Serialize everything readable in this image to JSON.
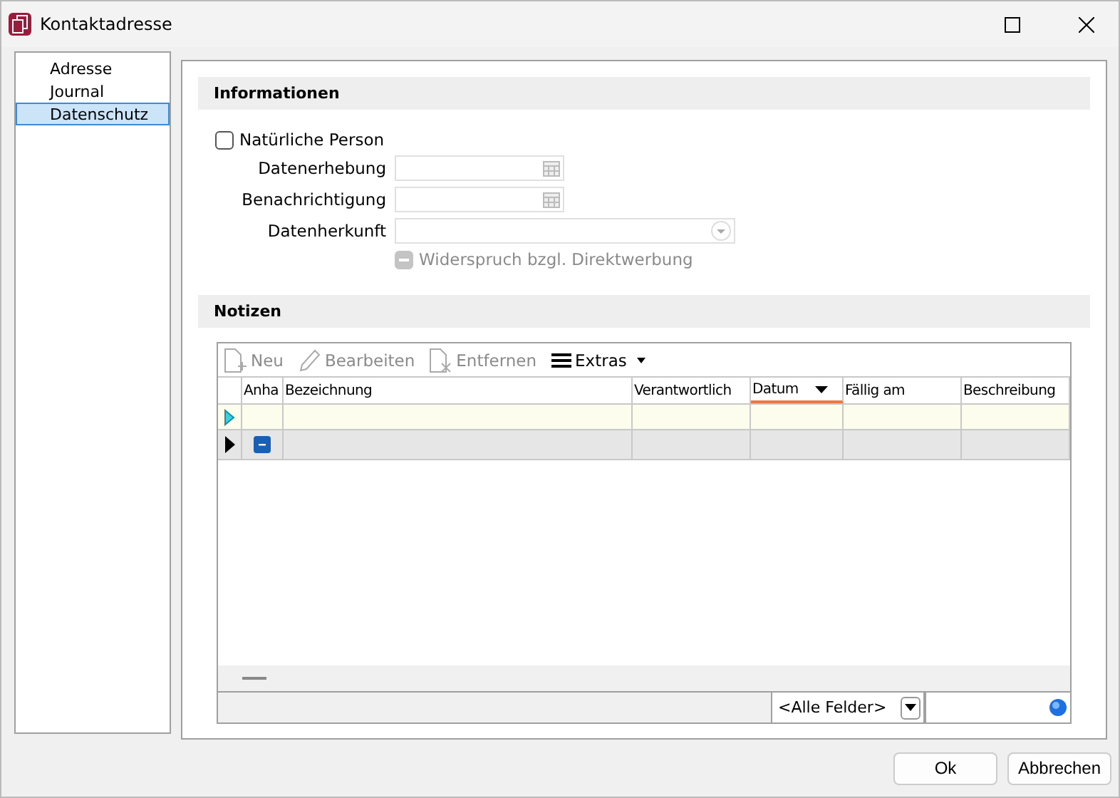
{
  "window": {
    "title": "Kontaktadresse"
  },
  "nav": {
    "items": [
      {
        "label": "Adresse",
        "selected": false
      },
      {
        "label": "Journal",
        "selected": false
      },
      {
        "label": "Datenschutz",
        "selected": true
      }
    ]
  },
  "informationen": {
    "title": "Informationen",
    "natural_person": {
      "label": "Natürliche Person",
      "checked": false
    },
    "fields": [
      {
        "label": "Datenerhebung",
        "kind": "date"
      },
      {
        "label": "Benachrichtigung",
        "kind": "date"
      },
      {
        "label": "Datenherkunft",
        "kind": "select"
      }
    ],
    "objection": {
      "label": "Widerspruch bzgl. Direktwerbung",
      "disabled": true
    }
  },
  "notizen": {
    "title": "Notizen",
    "toolbar": [
      {
        "label": "Neu",
        "kind": "new",
        "disabled": true
      },
      {
        "label": "Bearbeiten",
        "kind": "edit",
        "disabled": true
      },
      {
        "label": "Entfernen",
        "kind": "remove",
        "disabled": true
      },
      {
        "label": "Extras",
        "kind": "menu",
        "disabled": false
      }
    ],
    "columns": [
      {
        "label": "Anha",
        "sorted": false
      },
      {
        "label": "Bezeichnung",
        "sorted": false
      },
      {
        "label": "Verantwortlich",
        "sorted": false
      },
      {
        "label": "Datum",
        "sorted": true
      },
      {
        "label": "Fällig am",
        "sorted": false
      },
      {
        "label": "Beschreibung",
        "sorted": false
      }
    ],
    "rows": [
      {
        "kind": "new"
      },
      {
        "kind": "group"
      }
    ],
    "filter": "<Alle Felder>"
  },
  "buttons": [
    "Ok",
    "Abbrechen"
  ]
}
